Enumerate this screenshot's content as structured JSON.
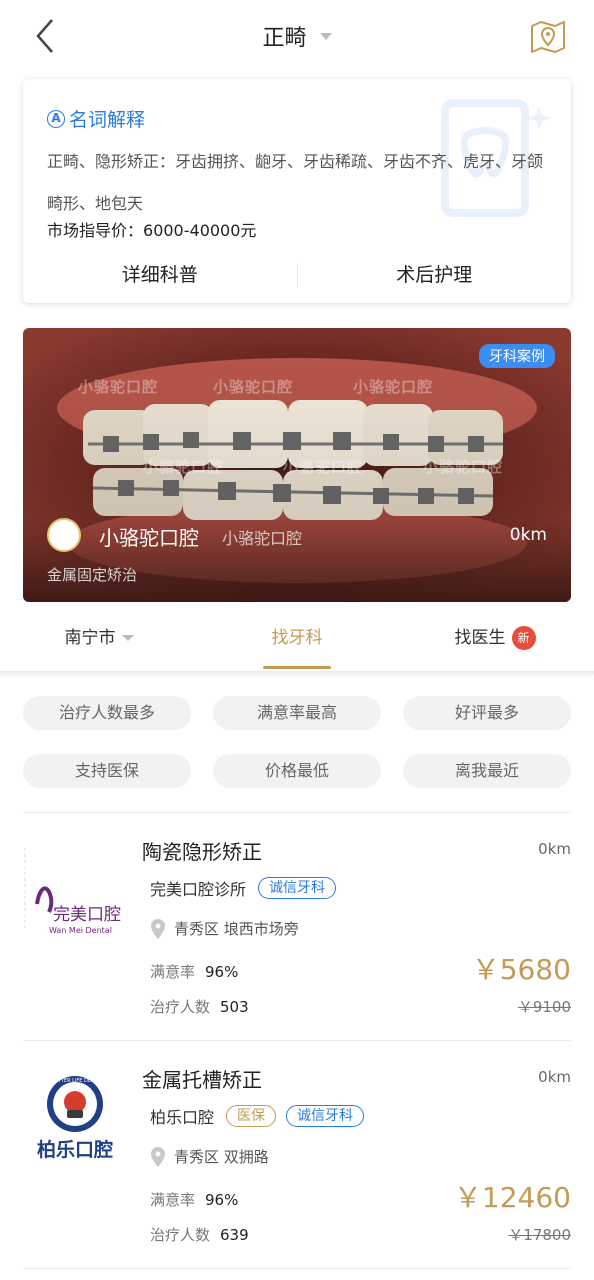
{
  "header": {
    "title": "正畸"
  },
  "glossary": {
    "title": "名词解释",
    "description": "正畸、隐形矫正：牙齿拥挤、龅牙、牙齿稀疏、牙齿不齐、虎牙、牙颌畸形、地包天",
    "price_label": "市场指导价：",
    "price_value": "6000-40000元",
    "actions": [
      "详细科普",
      "术后护理"
    ]
  },
  "case_banner": {
    "tag": "牙科案例",
    "clinic_name": "小骆驼口腔",
    "clinic_sub": "小骆驼口腔",
    "distance": "0km",
    "treatment": "金属固定矫治",
    "watermark": "小骆驼口腔"
  },
  "tabs": [
    {
      "label": "南宁市",
      "active": false
    },
    {
      "label": "找牙科",
      "active": true
    },
    {
      "label": "找医生",
      "active": false,
      "badge": "新"
    }
  ],
  "filters": [
    "治疗人数最多",
    "满意率最高",
    "好评最多",
    "支持医保",
    "价格最低",
    "离我最近"
  ],
  "items": [
    {
      "title": "陶瓷隐形矫正",
      "distance": "0km",
      "clinic": "完美口腔诊所",
      "badges": [
        {
          "text": "诚信牙科",
          "style": "blue"
        }
      ],
      "address": "青秀区 埌西市场旁",
      "satisfaction_label": "满意率",
      "satisfaction": "96%",
      "count_label": "治疗人数",
      "count": "503",
      "price": "￥5680",
      "original_price": "￥9100",
      "logo_text": "完美口腔",
      "logo_sub": "Wan Mei Dental"
    },
    {
      "title": "金属托槽矫正",
      "distance": "0km",
      "clinic": "柏乐口腔",
      "badges": [
        {
          "text": "医保",
          "style": "gold"
        },
        {
          "text": "诚信牙科",
          "style": "blue"
        }
      ],
      "address": "青秀区 双拥路",
      "satisfaction_label": "满意率",
      "satisfaction": "96%",
      "count_label": "治疗人数",
      "count": "639",
      "price": "￥12460",
      "original_price": "￥17800",
      "logo_text": "柏乐口腔",
      "logo_ring": "A BETTER LIFE DENTAL"
    }
  ],
  "colors": {
    "accent_gold": "#c49a55",
    "link_blue": "#2b7ce0",
    "badge_red": "#e94b3c"
  }
}
